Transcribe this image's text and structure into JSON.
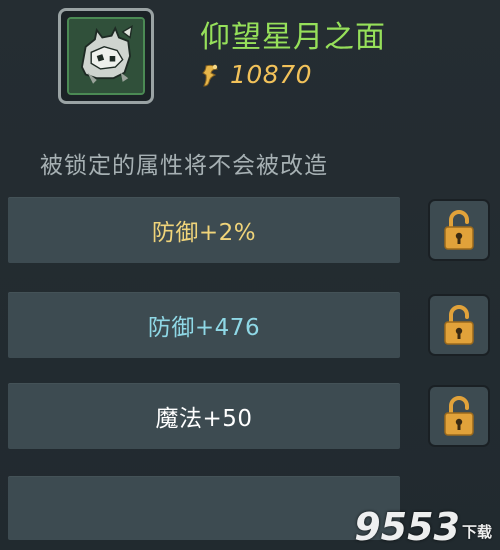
{
  "item": {
    "icon": "armor-mask-icon",
    "name": "仰望星月之面",
    "price_icon": "currency-icon",
    "price": "10870"
  },
  "hint": "被锁定的属性将不会被改造",
  "attributes": [
    {
      "label": "防御+2%",
      "color": "#f0d47a",
      "lock_icon": "unlocked-padlock-icon"
    },
    {
      "label": "防御+476",
      "color": "#8fd8e6",
      "lock_icon": "unlocked-padlock-icon"
    },
    {
      "label": "魔法+50",
      "color": "#ffffff",
      "lock_icon": "unlocked-padlock-icon"
    },
    {
      "label": "",
      "color": "#ffffff"
    }
  ],
  "colors": {
    "item_name": "#96e05a",
    "price": "#f2c25a",
    "hint": "#a6b0b3",
    "row_bg": "#3d4b51",
    "lock": "#e1a23a"
  },
  "watermark": {
    "number": "9553",
    "text": "下载"
  }
}
